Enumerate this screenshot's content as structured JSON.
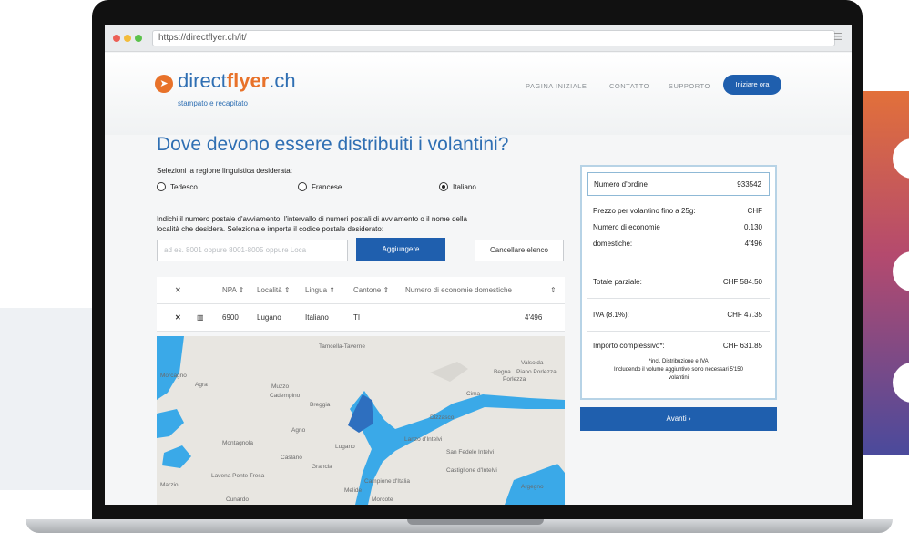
{
  "browser": {
    "url": "https://directflyer.ch/it/"
  },
  "header": {
    "logo_prefix": "direct",
    "logo_bold": "flyer",
    "logo_suffix": ".ch",
    "tagline": "stampato e recapitato",
    "nav": [
      "PAGINA INIZIALE",
      "CONTATTO",
      "SUPPORTO"
    ],
    "cta_label": "Iniziare ora"
  },
  "main": {
    "headline": "Dove devono essere distribuiti i volantini?",
    "region_label": "Selezioni la regione linguistica desiderata:",
    "regions": [
      {
        "label": "Tedesco",
        "selected": false
      },
      {
        "label": "Francese",
        "selected": false
      },
      {
        "label": "Italiano",
        "selected": true
      }
    ],
    "instruction_line1": "Indichi il numero postale d'avviamento, l'intervallo di numeri postali di avviamento o il nome della",
    "instruction_line2": "località che desidera. Seleziona e importa il codice postale desiderato:",
    "input_placeholder": "ad es. 8001 oppure 8001-8005 oppure Loca",
    "add_label": "Aggiungere",
    "clear_label": "Cancellare elenco",
    "table": {
      "headers": [
        "NPA",
        "Località",
        "Lingua",
        "Cantone",
        "Numero di economie domestiche"
      ],
      "rows": [
        {
          "npa": "6900",
          "localita": "Lugano",
          "lingua": "Italiano",
          "cantone": "TI",
          "economie": "4'496"
        }
      ]
    },
    "map_labels": [
      "Tamcella-Taverne",
      "Morcagno",
      "Agra",
      "Muzzo",
      "Breggia",
      "Agno",
      "Cadempino",
      "Lugano",
      "Caslano",
      "Montagnola",
      "Grancia",
      "Campione d'Italia",
      "Morcote",
      "Melide",
      "Lanzo d'Intelvi",
      "San Fedele Intelvi",
      "Castiglione d'Intelvi",
      "Argegno",
      "Dizzasco",
      "Porlezza",
      "Begna",
      "Piano Porlezza",
      "Cima",
      "Valsolda",
      "Lavena Ponte Tresa",
      "Marzio",
      "Cunardo"
    ]
  },
  "summary": {
    "order_label": "Numero d'ordine",
    "order_value": "933542",
    "price_label": "Prezzo per volantino fino a 25g:",
    "price_currency": "CHF",
    "price_value": "0.130",
    "households_label1": "Numero di economie",
    "households_label2": "domestiche:",
    "households_value": "4'496",
    "subtotal_label": "Totale parziale:",
    "subtotal_value": "CHF 584.50",
    "vat_label": "IVA (8.1%):",
    "vat_value": "CHF 47.35",
    "total_label": "Importo complessivo*:",
    "total_value": "CHF 631.85",
    "note_line1": "*incl. Distribuzione e IVA",
    "note_line2": "Includendo il volume aggiuntivo sono necessari 5'150",
    "note_line3": "volantini",
    "next_label": "Avanti ›"
  },
  "colors": {
    "brand_blue": "#1f5fae",
    "brand_orange": "#e8722a",
    "lake_blue": "#3aa9e8"
  }
}
